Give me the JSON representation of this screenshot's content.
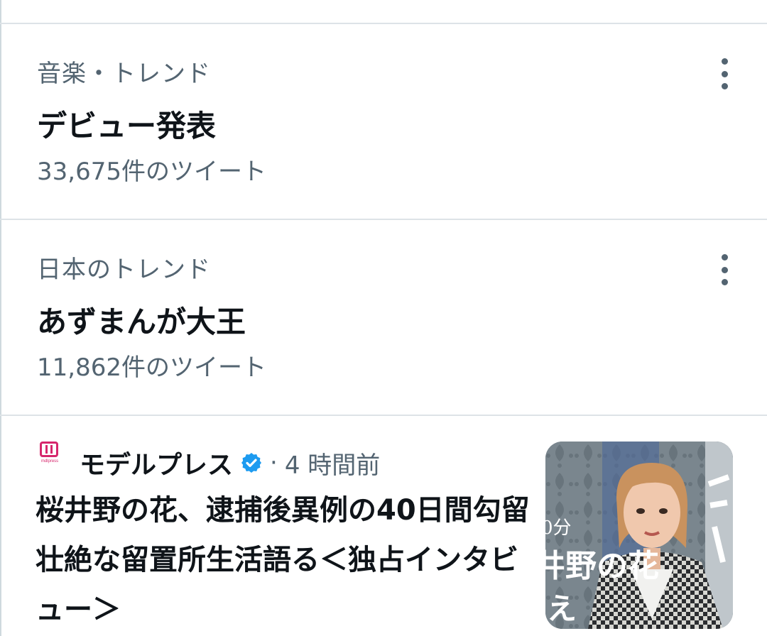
{
  "trends": [
    {
      "context": "音楽・トレンド",
      "title": "デビュー発表",
      "count": "33,675件のツイート"
    },
    {
      "context": "日本のトレンド",
      "title": "あずまんが大王",
      "count": "11,862件のツイート"
    }
  ],
  "news": {
    "logo_text": "mdlpress",
    "source": "モデルプレス",
    "separator": "·",
    "time": "4 時間前",
    "headline": "桜井野の花、逮捕後異例の40日間勾留 壮絶な留置所生活語る＜独占インタビュー＞",
    "thumbnail_text": {
      "line1": "0分",
      "line2": "井野の花",
      "line3": "え"
    }
  },
  "colors": {
    "brand_pink": "#d6276c",
    "verified_blue": "#1d9bf0",
    "secondary_text": "#536471"
  },
  "icons": [
    "more-vertical-icon",
    "verified-badge-icon",
    "modelpress-logo-icon"
  ]
}
